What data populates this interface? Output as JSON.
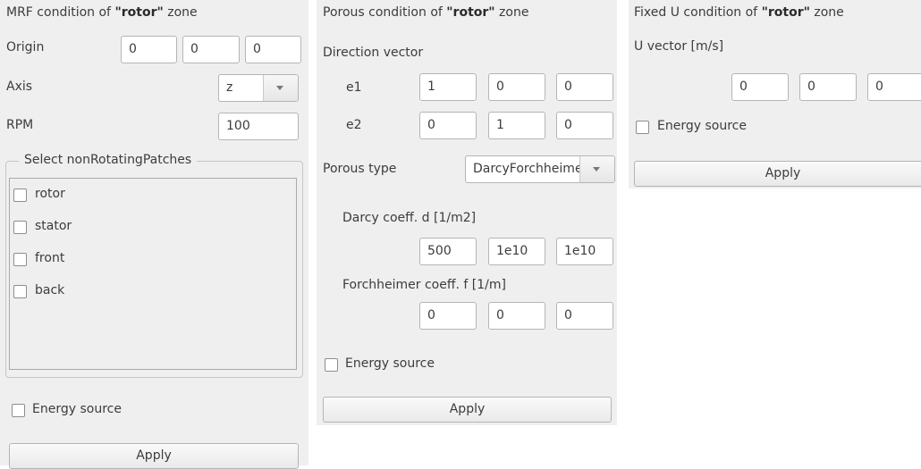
{
  "mrf": {
    "title_prefix": "MRF condition of ",
    "zone_name": "\"rotor\"",
    "title_suffix": " zone",
    "origin_label": "Origin",
    "origin_values": [
      "0",
      "0",
      "0"
    ],
    "axis_label": "Axis",
    "axis_value": "z",
    "rpm_label": "RPM",
    "rpm_value": "100",
    "patches_group_title": "Select nonRotatingPatches",
    "patches": [
      "rotor",
      "stator",
      "front",
      "back"
    ],
    "energy_source_label": "Energy source",
    "apply_label": "Apply"
  },
  "porous": {
    "title_prefix": "Porous condition of ",
    "zone_name": "\"rotor\"",
    "title_suffix": " zone",
    "direction_label": "Direction vector",
    "e1_label": "e1",
    "e1_values": [
      "1",
      "0",
      "0"
    ],
    "e2_label": "e2",
    "e2_values": [
      "0",
      "1",
      "0"
    ],
    "type_label": "Porous type",
    "type_value": "DarcyForchheimer",
    "darcy_label": "Darcy coeff. d [1/m2]",
    "darcy_values": [
      "500",
      "1e10",
      "1e10"
    ],
    "forch_label": "Forchheimer coeff. f [1/m]",
    "forch_values": [
      "0",
      "0",
      "0"
    ],
    "energy_source_label": "Energy source",
    "apply_label": "Apply"
  },
  "fixedu": {
    "title_prefix": "Fixed U condition of ",
    "zone_name": "\"rotor\"",
    "title_suffix": " zone",
    "vector_label": "U vector [m/s]",
    "vector_values": [
      "0",
      "0",
      "0"
    ],
    "energy_source_label": "Energy source",
    "apply_label": "Apply"
  }
}
